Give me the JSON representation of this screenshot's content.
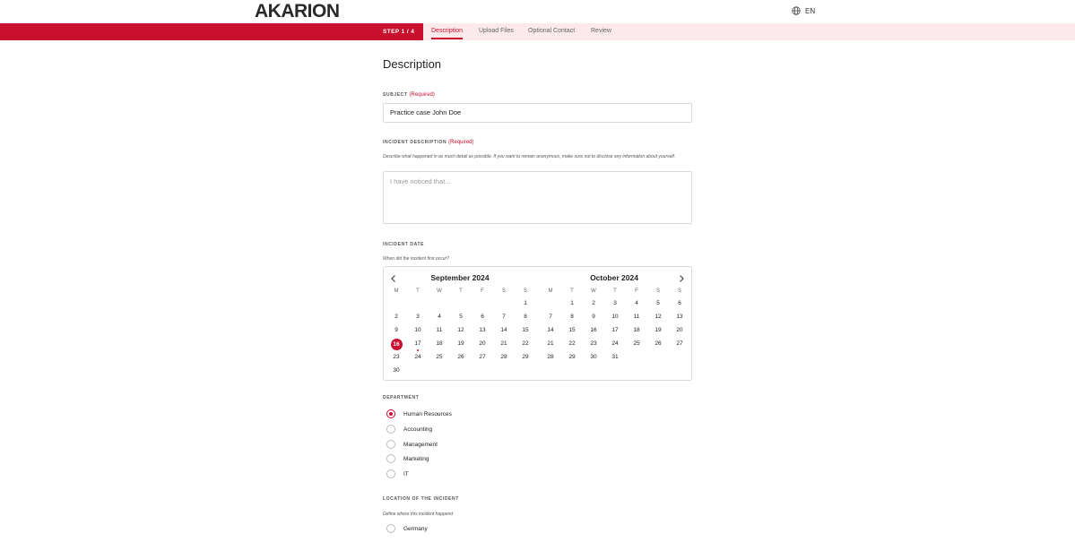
{
  "header": {
    "logo_text": "AKARION",
    "language": "EN"
  },
  "stepbar": {
    "step_label": "STEP 1 / 4",
    "tabs": [
      "Description",
      "Upload Files",
      "Optional Contact",
      "Review"
    ],
    "active_tab": "Description"
  },
  "page_title": "Description",
  "subject": {
    "label": "SUBJECT",
    "required": "(Required)",
    "value": "Practice case John Doe"
  },
  "incident_description": {
    "label": "INCIDENT DESCRIPTION",
    "required": "(Required)",
    "hint": "Describe what happened in as much detail as possible. If you want to remain anonymous, make sure not to disclose any information about yourself.",
    "placeholder": "I have noticed that..."
  },
  "incident_date": {
    "label": "INCIDENT DATE",
    "hint": "When did the incident first occur?",
    "weekdays": [
      "M",
      "T",
      "W",
      "T",
      "F",
      "S",
      "S"
    ],
    "months": [
      {
        "title": "September 2024",
        "weeks": [
          [
            "",
            "",
            "",
            "",
            "",
            "",
            "1"
          ],
          [
            "2",
            "3",
            "4",
            "5",
            "6",
            "7",
            "8"
          ],
          [
            "9",
            "10",
            "11",
            "12",
            "13",
            "14",
            "15"
          ],
          [
            "16",
            "17",
            "18",
            "19",
            "20",
            "21",
            "22"
          ],
          [
            "23",
            "24",
            "25",
            "26",
            "27",
            "28",
            "29"
          ],
          [
            "30",
            "",
            "",
            "",
            "",
            "",
            ""
          ]
        ]
      },
      {
        "title": "October 2024",
        "weeks": [
          [
            "",
            "1",
            "2",
            "3",
            "4",
            "5",
            "6"
          ],
          [
            "7",
            "8",
            "9",
            "10",
            "11",
            "12",
            "13"
          ],
          [
            "14",
            "15",
            "16",
            "17",
            "18",
            "19",
            "20"
          ],
          [
            "21",
            "22",
            "23",
            "24",
            "25",
            "26",
            "27"
          ],
          [
            "28",
            "29",
            "30",
            "31",
            "",
            "",
            ""
          ]
        ]
      }
    ],
    "selected_day": "16",
    "today_marker_day": "17",
    "accent_color": "#c8102e"
  },
  "department": {
    "label": "DEPARTMENT",
    "options": [
      "Human Resources",
      "Accounting",
      "Management",
      "Marketing",
      "IT"
    ],
    "selected": "Human Resources"
  },
  "location": {
    "label": "LOCATION OF THE INCIDENT",
    "hint": "Define where this incident happend",
    "options": [
      "Germany"
    ]
  },
  "colors": {
    "brand_red": "#c8102e",
    "stepbar_bg": "#fbe9ec"
  }
}
